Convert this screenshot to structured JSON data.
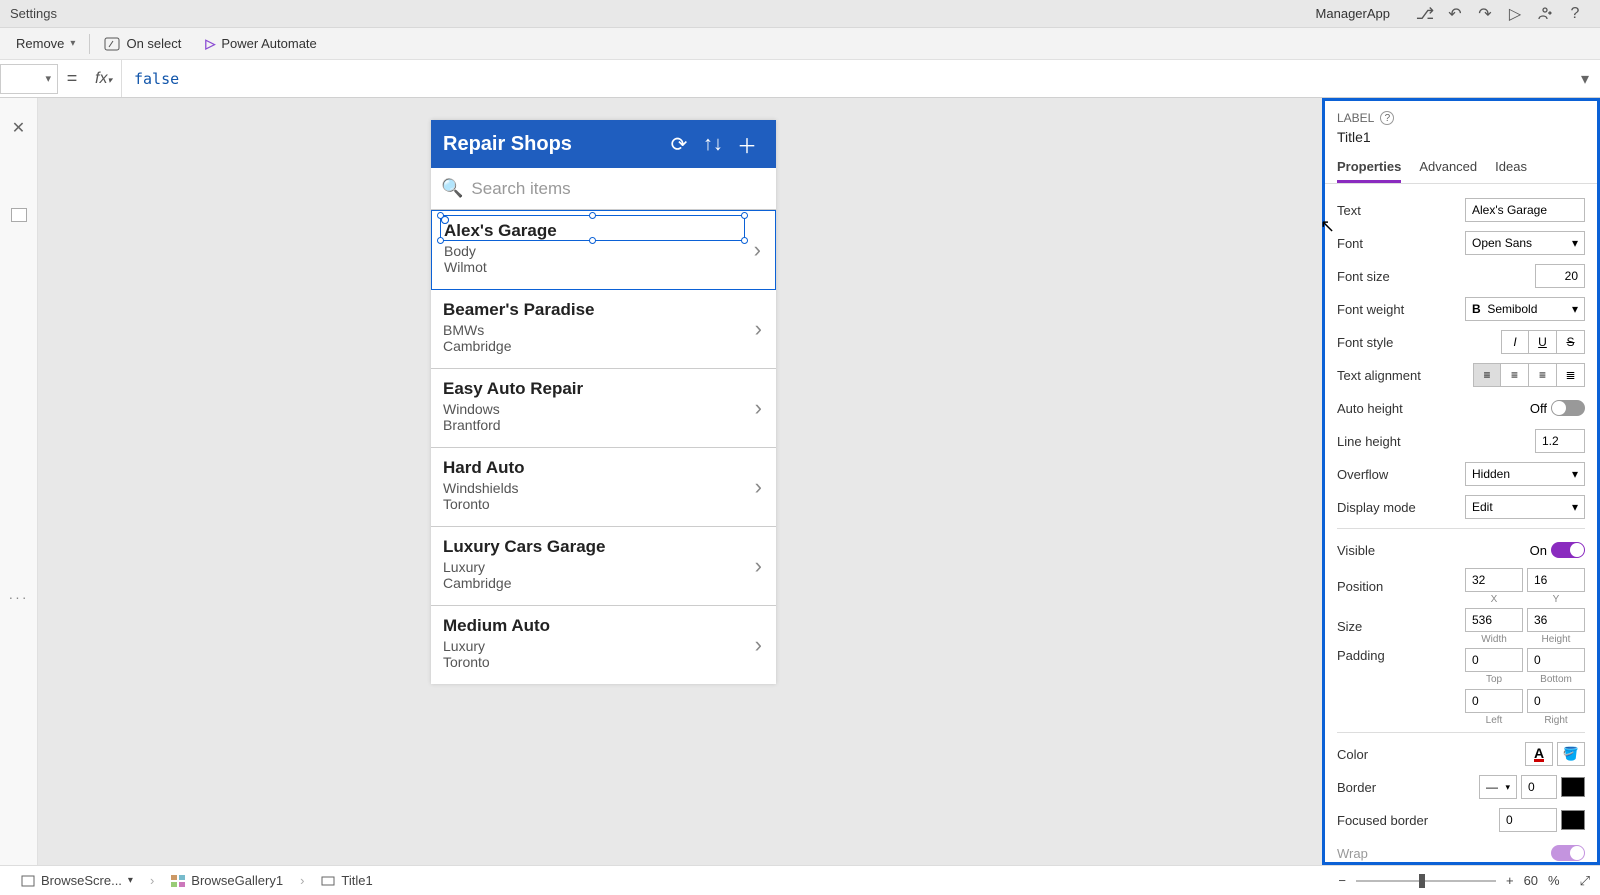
{
  "titlebar": {
    "title": "Settings",
    "app": "ManagerApp"
  },
  "cmdbar": {
    "remove": "Remove",
    "onselect": "On select",
    "powerautomate": "Power Automate"
  },
  "formula": {
    "value": "false"
  },
  "phone": {
    "header": "Repair Shops",
    "search_placeholder": "Search items",
    "items": [
      {
        "title": "Alex's Garage",
        "sub1": "Body",
        "sub2": "Wilmot"
      },
      {
        "title": "Beamer's Paradise",
        "sub1": "BMWs",
        "sub2": "Cambridge"
      },
      {
        "title": "Easy Auto Repair",
        "sub1": "Windows",
        "sub2": "Brantford"
      },
      {
        "title": "Hard Auto",
        "sub1": "Windshields",
        "sub2": "Toronto"
      },
      {
        "title": "Luxury Cars Garage",
        "sub1": "Luxury",
        "sub2": "Cambridge"
      },
      {
        "title": "Medium Auto",
        "sub1": "Luxury",
        "sub2": "Toronto"
      }
    ]
  },
  "props": {
    "type": "LABEL",
    "name": "Title1",
    "tabs": {
      "properties": "Properties",
      "advanced": "Advanced",
      "ideas": "Ideas"
    },
    "labels": {
      "text": "Text",
      "font": "Font",
      "fontsize": "Font size",
      "fontweight": "Font weight",
      "fontstyle": "Font style",
      "textalign": "Text alignment",
      "autoheight": "Auto height",
      "lineheight": "Line height",
      "overflow": "Overflow",
      "displaymode": "Display mode",
      "visible": "Visible",
      "position": "Position",
      "size": "Size",
      "padding": "Padding",
      "color": "Color",
      "border": "Border",
      "focusedborder": "Focused border",
      "wrap": "Wrap"
    },
    "values": {
      "text": "Alex's Garage",
      "font": "Open Sans",
      "fontsize": "20",
      "fontweight": "Semibold",
      "autoheight": "Off",
      "lineheight": "1.2",
      "overflow": "Hidden",
      "displaymode": "Edit",
      "visible": "On",
      "pos_x": "32",
      "pos_y": "16",
      "size_w": "536",
      "size_h": "36",
      "pad_t": "0",
      "pad_b": "0",
      "pad_l": "0",
      "pad_r": "0",
      "border_w": "0",
      "focusedborder_w": "0"
    },
    "sublabels": {
      "x": "X",
      "y": "Y",
      "w": "Width",
      "h": "Height",
      "t": "Top",
      "b": "Bottom",
      "l": "Left",
      "r": "Right"
    }
  },
  "statusbar": {
    "crumb1": "BrowseScre...",
    "crumb2": "BrowseGallery1",
    "crumb3": "Title1",
    "zoom": "60",
    "zoom_pct": "%"
  }
}
